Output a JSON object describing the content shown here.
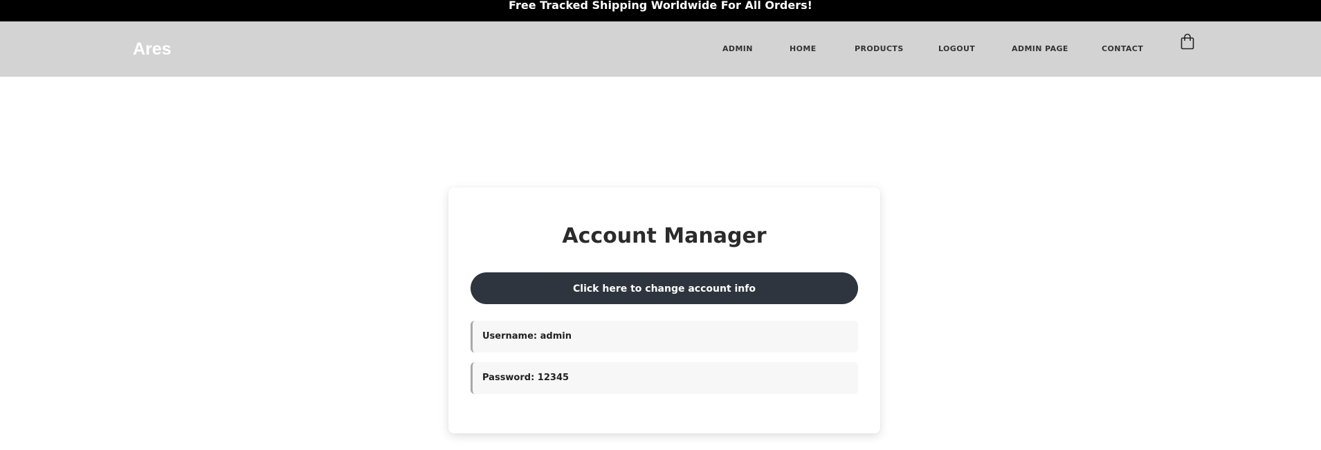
{
  "announcement": "Free Tracked Shipping Worldwide For All Orders!",
  "brand": "Ares",
  "nav": {
    "admin": "ADMIN",
    "home": "HOME",
    "products": "PRODUCTS",
    "logout": "LOGOUT",
    "admin_page": "ADMIN PAGE",
    "contact": "CONTACT"
  },
  "cart_icon": "shopping-bag-icon",
  "account": {
    "title": "Account Manager",
    "change_button": "Click here to change account info",
    "username": "Username: admin",
    "password": "Password: 12345"
  },
  "colors": {
    "topbar": "#000000",
    "header": "#d3d3d3",
    "button": "#2f353e",
    "row_bg": "#f7f7f7",
    "row_accent": "#a9a9a9"
  }
}
